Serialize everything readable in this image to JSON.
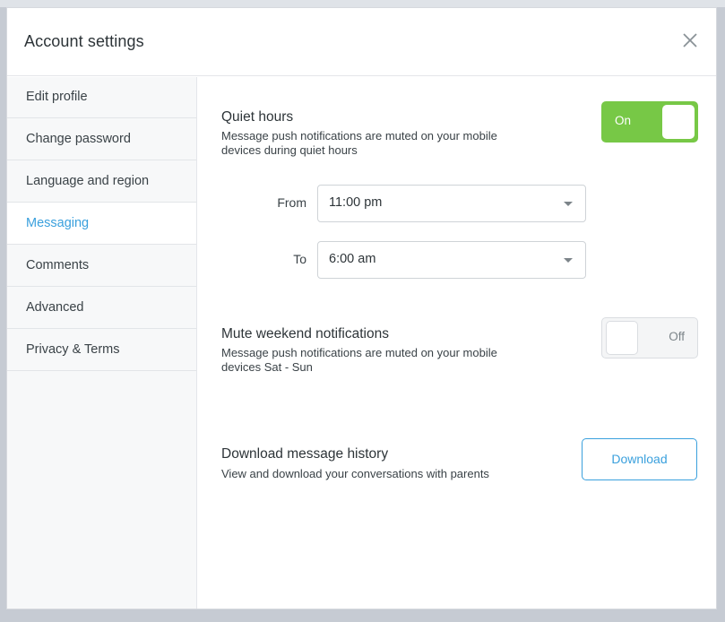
{
  "modal": {
    "title": "Account settings"
  },
  "sidebar": {
    "items": [
      {
        "label": "Edit profile"
      },
      {
        "label": "Change password"
      },
      {
        "label": "Language and region"
      },
      {
        "label": "Messaging",
        "active": true
      },
      {
        "label": "Comments"
      },
      {
        "label": "Advanced"
      },
      {
        "label": "Privacy & Terms"
      }
    ]
  },
  "quiet_hours": {
    "title": "Quiet hours",
    "description": "Message push notifications are muted on your mobile devices during quiet hours",
    "toggle_label": "On",
    "from_label": "From",
    "from_value": "11:00 pm",
    "to_label": "To",
    "to_value": "6:00 am"
  },
  "mute_weekend": {
    "title": "Mute weekend notifications",
    "description": "Message push notifications are muted on your mobile devices Sat - Sun",
    "toggle_label": "Off"
  },
  "download_history": {
    "title": "Download message history",
    "description": "View and download your conversations with parents",
    "button_label": "Download"
  },
  "colors": {
    "accent": "#3aa0dd",
    "toggle_on": "#77c846"
  },
  "icons": {
    "close": "close-icon",
    "dropdown": "chevron-down-icon"
  }
}
